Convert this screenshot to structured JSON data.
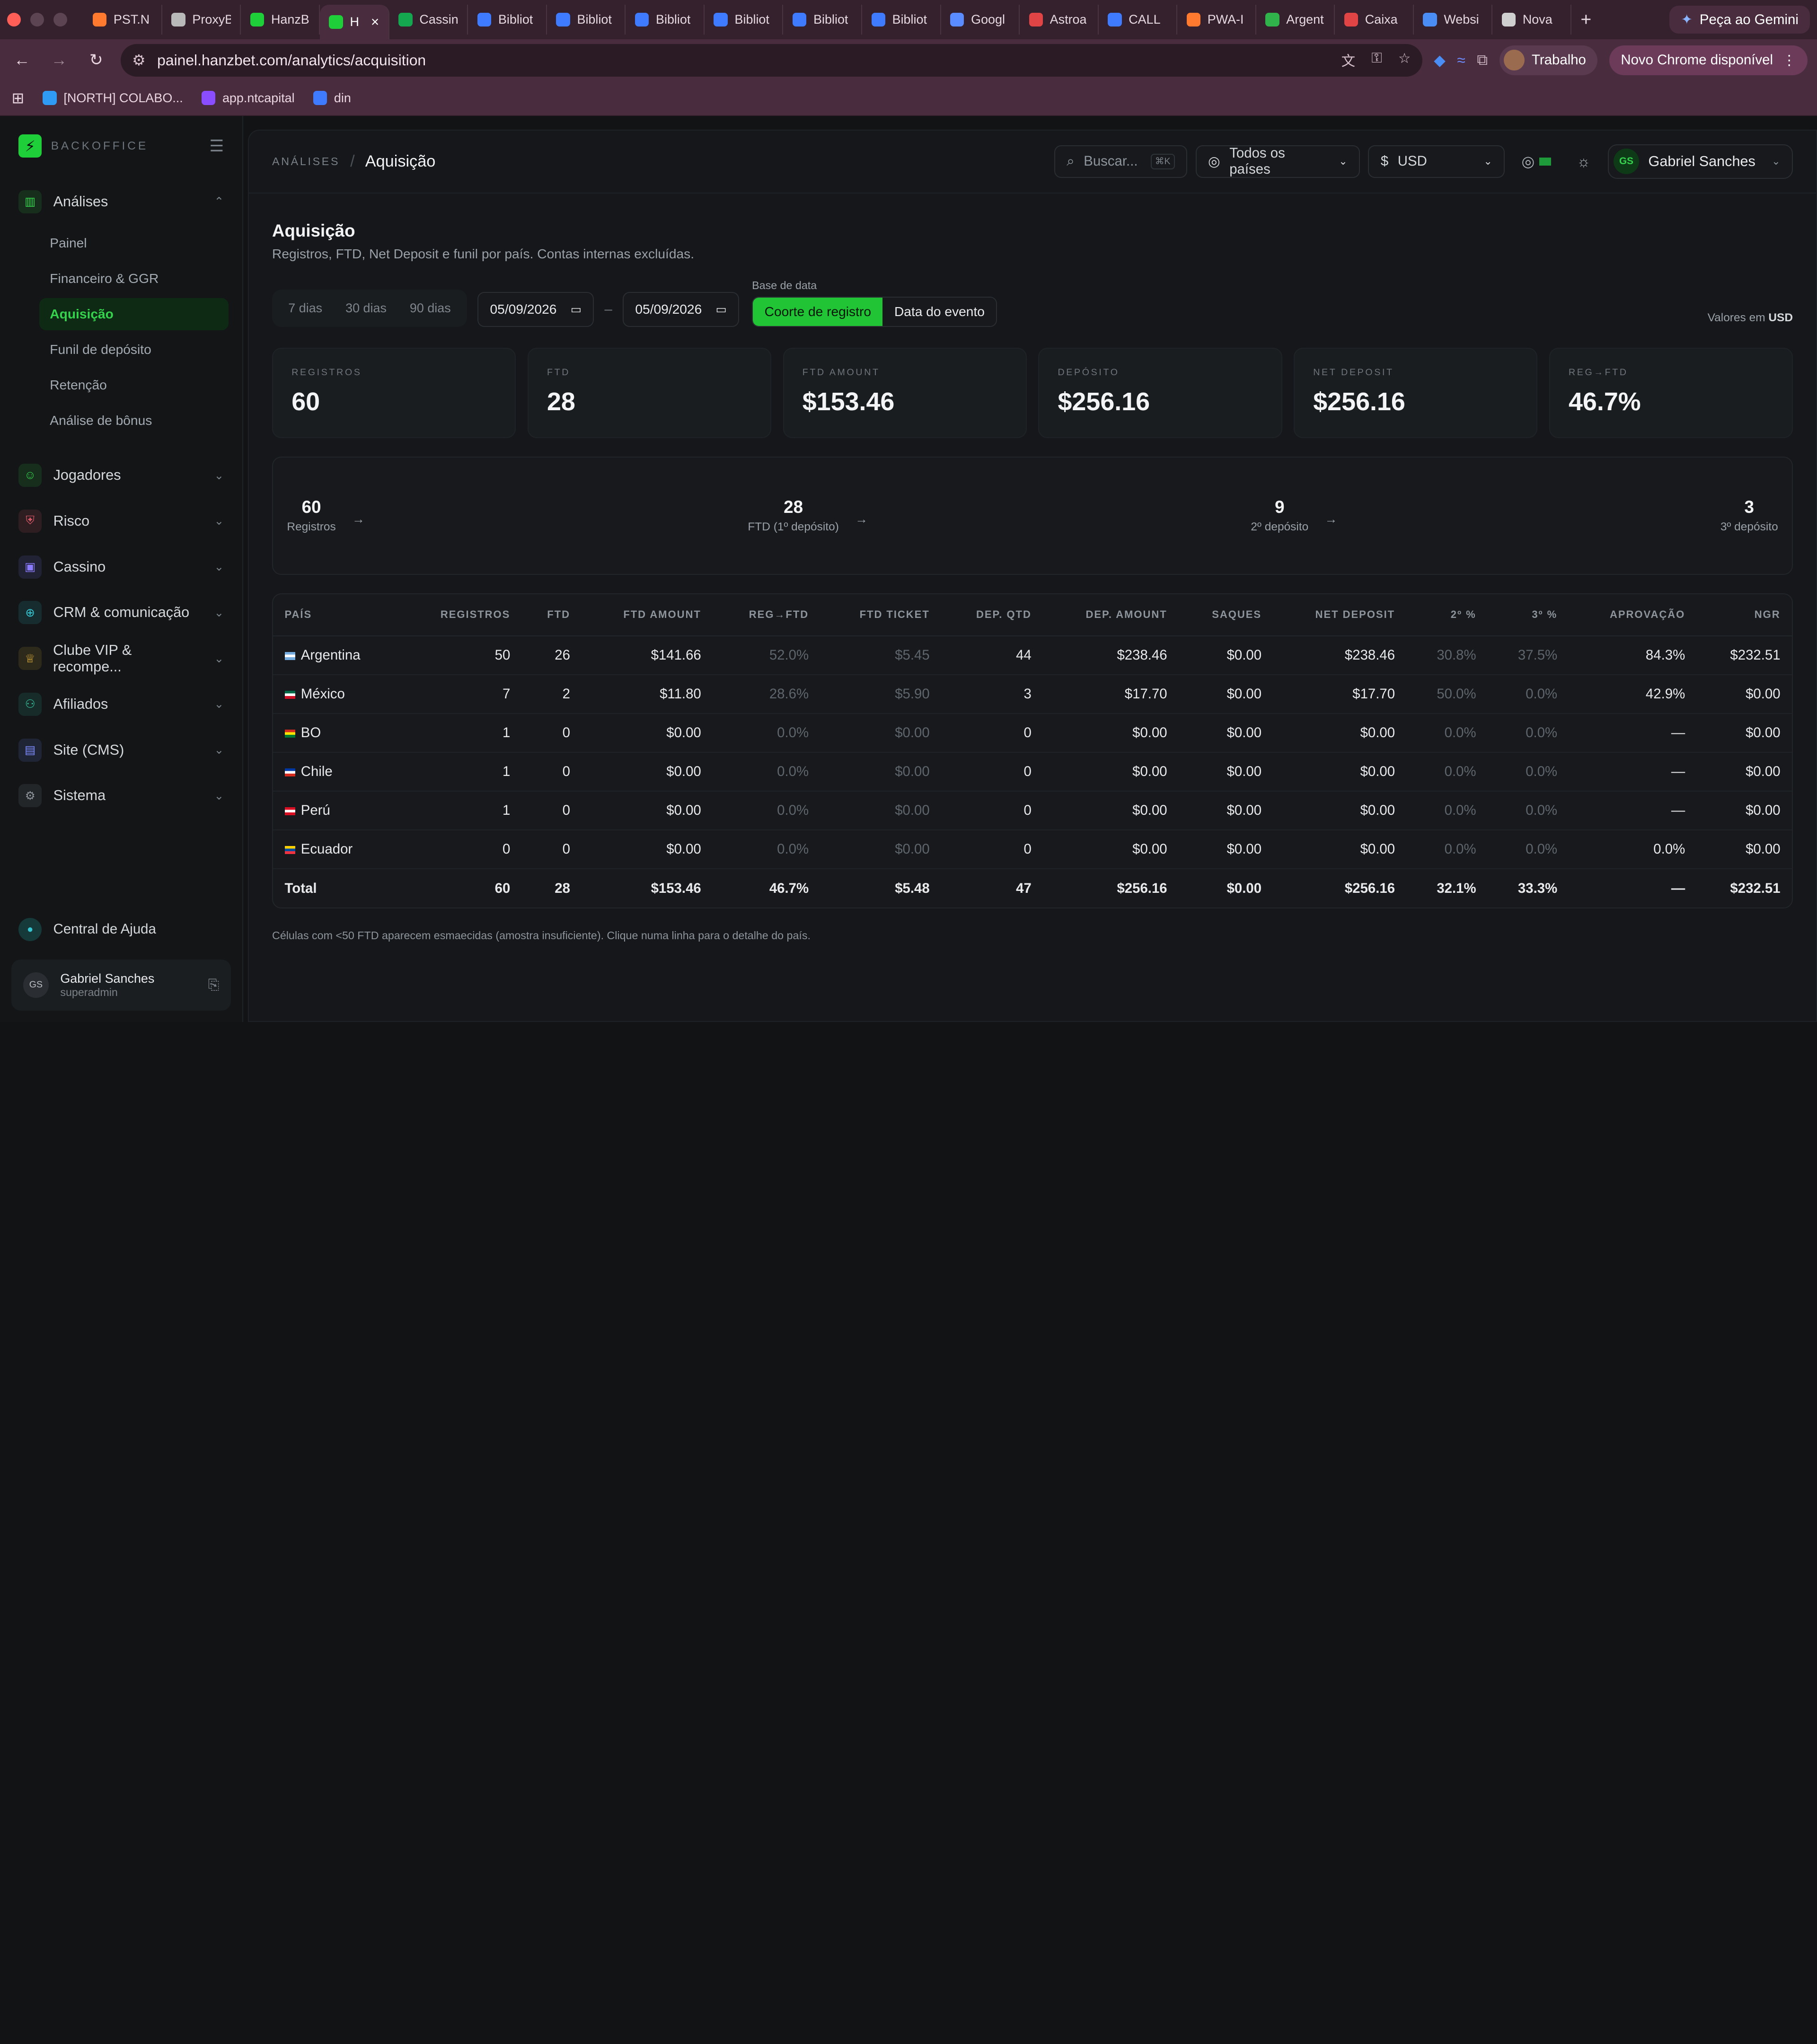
{
  "browser": {
    "tabs": [
      {
        "title": "PST.N",
        "color": "#ff7a2e"
      },
      {
        "title": "ProxyB",
        "color": "#b9b9b9"
      },
      {
        "title": "HanzB",
        "color": "#1fcf3a"
      },
      {
        "title": "Ha",
        "color": "#1fcf3a",
        "active": true
      },
      {
        "title": "Cassin",
        "color": "#14a750"
      },
      {
        "title": "Bibliot",
        "color": "#3f7bff"
      },
      {
        "title": "Bibliot",
        "color": "#3f7bff"
      },
      {
        "title": "Bibliot",
        "color": "#3f7bff"
      },
      {
        "title": "Bibliot",
        "color": "#3f7bff"
      },
      {
        "title": "Bibliot",
        "color": "#3f7bff"
      },
      {
        "title": "Bibliot",
        "color": "#3f7bff"
      },
      {
        "title": "Googl",
        "color": "#5a8bff"
      },
      {
        "title": "Astroa",
        "color": "#e04444"
      },
      {
        "title": "CALL",
        "color": "#3f7bff"
      },
      {
        "title": "PWA-I",
        "color": "#ff7a2e"
      },
      {
        "title": "Argent",
        "color": "#2fb34a"
      },
      {
        "title": "Caixa",
        "color": "#e04444"
      },
      {
        "title": "Websi",
        "color": "#4a8ef5"
      },
      {
        "title": "Nova",
        "color": "#cfcfcf"
      }
    ],
    "gemini_label": "Peça ao Gemini",
    "url": "painel.hanzbet.com/analytics/acquisition",
    "profile_label": "Trabalho",
    "update_label": "Novo Chrome disponível",
    "bookmarks": [
      {
        "label": "[NORTH] COLABO...",
        "color": "#2f9bf5"
      },
      {
        "label": "app.ntcapital",
        "color": "#8a4dff"
      },
      {
        "label": "din",
        "color": "#3f7bff"
      }
    ]
  },
  "sidebar": {
    "brand": "BACKOFFICE",
    "groups": [
      {
        "label": "Análises",
        "color": "#35d24d",
        "expanded": true
      },
      {
        "label": "Jogadores",
        "color": "#35d24d"
      },
      {
        "label": "Risco",
        "color": "#e25a6a"
      },
      {
        "label": "Cassino",
        "color": "#8a7bff"
      },
      {
        "label": "CRM & comunicação",
        "color": "#35c6d2"
      },
      {
        "label": "Clube VIP & recompe...",
        "color": "#e2b23a"
      },
      {
        "label": "Afiliados",
        "color": "#35c6a2"
      },
      {
        "label": "Site (CMS)",
        "color": "#7b8bff"
      },
      {
        "label": "Sistema",
        "color": "#8d949b"
      }
    ],
    "analises_items": [
      "Painel",
      "Financeiro & GGR",
      "Aquisição",
      "Funil de depósito",
      "Retenção",
      "Análise de bônus"
    ],
    "active_item": "Aquisição",
    "help": "Central de Ajuda",
    "user": {
      "initials": "GS",
      "name": "Gabriel Sanches",
      "role": "superadmin"
    }
  },
  "topbar": {
    "crumb_root": "ANÁLISES",
    "crumb_current": "Aquisição",
    "search_placeholder": "Buscar...",
    "search_kbd": "⌘K",
    "country_filter": "Todos os países",
    "currency_symbol": "$",
    "currency": "USD",
    "user_initials": "GS",
    "user_name": "Gabriel Sanches"
  },
  "page": {
    "title": "Aquisição",
    "subtitle": "Registros, FTD, Net Deposit e funil por país. Contas internas excluídas.",
    "presets": [
      "7 dias",
      "30 dias",
      "90 dias"
    ],
    "date_from": "05/09/2026",
    "date_to": "05/09/2026",
    "date_sep": "–",
    "base_label": "Base de data",
    "base_options": [
      "Coorte de registro",
      "Data do evento"
    ],
    "base_selected": "Coorte de registro",
    "values_in_prefix": "Valores em",
    "values_in_currency": "USD",
    "footnote": "Células com <50 FTD aparecem esmaecidas (amostra insuficiente). Clique numa linha para o detalhe do país."
  },
  "kpis": [
    {
      "label": "REGISTROS",
      "value": "60"
    },
    {
      "label": "FTD",
      "value": "28"
    },
    {
      "label": "FTD AMOUNT",
      "value": "$153.46"
    },
    {
      "label": "DEPÓSITO",
      "value": "$256.16"
    },
    {
      "label": "NET DEPOSIT",
      "value": "$256.16"
    },
    {
      "label": "REG→FTD",
      "value": "46.7%"
    }
  ],
  "funnel": [
    {
      "value": "60",
      "label": "Registros"
    },
    {
      "value": "28",
      "label": "FTD (1º depósito)"
    },
    {
      "value": "9",
      "label": "2º depósito"
    },
    {
      "value": "3",
      "label": "3º depósito"
    }
  ],
  "table": {
    "columns": [
      "PAÍS",
      "REGISTROS",
      "FTD",
      "FTD AMOUNT",
      "REG→FTD",
      "FTD TICKET",
      "DEP. QTD",
      "DEP. AMOUNT",
      "SAQUES",
      "NET DEPOSIT",
      "2º %",
      "3º %",
      "APROVAÇÃO",
      "NGR"
    ],
    "rows": [
      {
        "country": "Argentina",
        "flag": [
          "#74acdf",
          "#ffffff",
          "#74acdf"
        ],
        "cells": [
          "50",
          "26",
          "$141.66",
          "52.0%",
          "$5.45",
          "44",
          "$238.46",
          "$0.00",
          "$238.46",
          "30.8%",
          "37.5%",
          "84.3%",
          "$232.51"
        ]
      },
      {
        "country": "México",
        "flag": [
          "#006847",
          "#ffffff",
          "#ce1126"
        ],
        "cells": [
          "7",
          "2",
          "$11.80",
          "28.6%",
          "$5.90",
          "3",
          "$17.70",
          "$0.00",
          "$17.70",
          "50.0%",
          "0.0%",
          "42.9%",
          "$0.00"
        ]
      },
      {
        "country": "BO",
        "flag": [
          "#d52b1e",
          "#f9e300",
          "#007934"
        ],
        "cells": [
          "1",
          "0",
          "$0.00",
          "0.0%",
          "$0.00",
          "0",
          "$0.00",
          "$0.00",
          "$0.00",
          "0.0%",
          "0.0%",
          "—",
          "$0.00"
        ]
      },
      {
        "country": "Chile",
        "flag": [
          "#0039a6",
          "#ffffff",
          "#d52b1e"
        ],
        "cells": [
          "1",
          "0",
          "$0.00",
          "0.0%",
          "$0.00",
          "0",
          "$0.00",
          "$0.00",
          "$0.00",
          "0.0%",
          "0.0%",
          "—",
          "$0.00"
        ]
      },
      {
        "country": "Perú",
        "flag": [
          "#d91023",
          "#ffffff",
          "#d91023"
        ],
        "cells": [
          "1",
          "0",
          "$0.00",
          "0.0%",
          "$0.00",
          "0",
          "$0.00",
          "$0.00",
          "$0.00",
          "0.0%",
          "0.0%",
          "—",
          "$0.00"
        ]
      },
      {
        "country": "Ecuador",
        "flag": [
          "#ffd100",
          "#034ea2",
          "#ef3340"
        ],
        "cells": [
          "0",
          "0",
          "$0.00",
          "0.0%",
          "$0.00",
          "0",
          "$0.00",
          "$0.00",
          "$0.00",
          "0.0%",
          "0.0%",
          "0.0%",
          "$0.00"
        ]
      }
    ],
    "total": {
      "label": "Total",
      "cells": [
        "60",
        "28",
        "$153.46",
        "46.7%",
        "$5.48",
        "47",
        "$256.16",
        "$0.00",
        "$256.16",
        "32.1%",
        "33.3%",
        "—",
        "$232.51"
      ]
    },
    "dim_columns": [
      3,
      4,
      9,
      10
    ]
  },
  "colors": {
    "accent": "#21c434",
    "accent_text": "#35d24d",
    "background": "#111315"
  }
}
